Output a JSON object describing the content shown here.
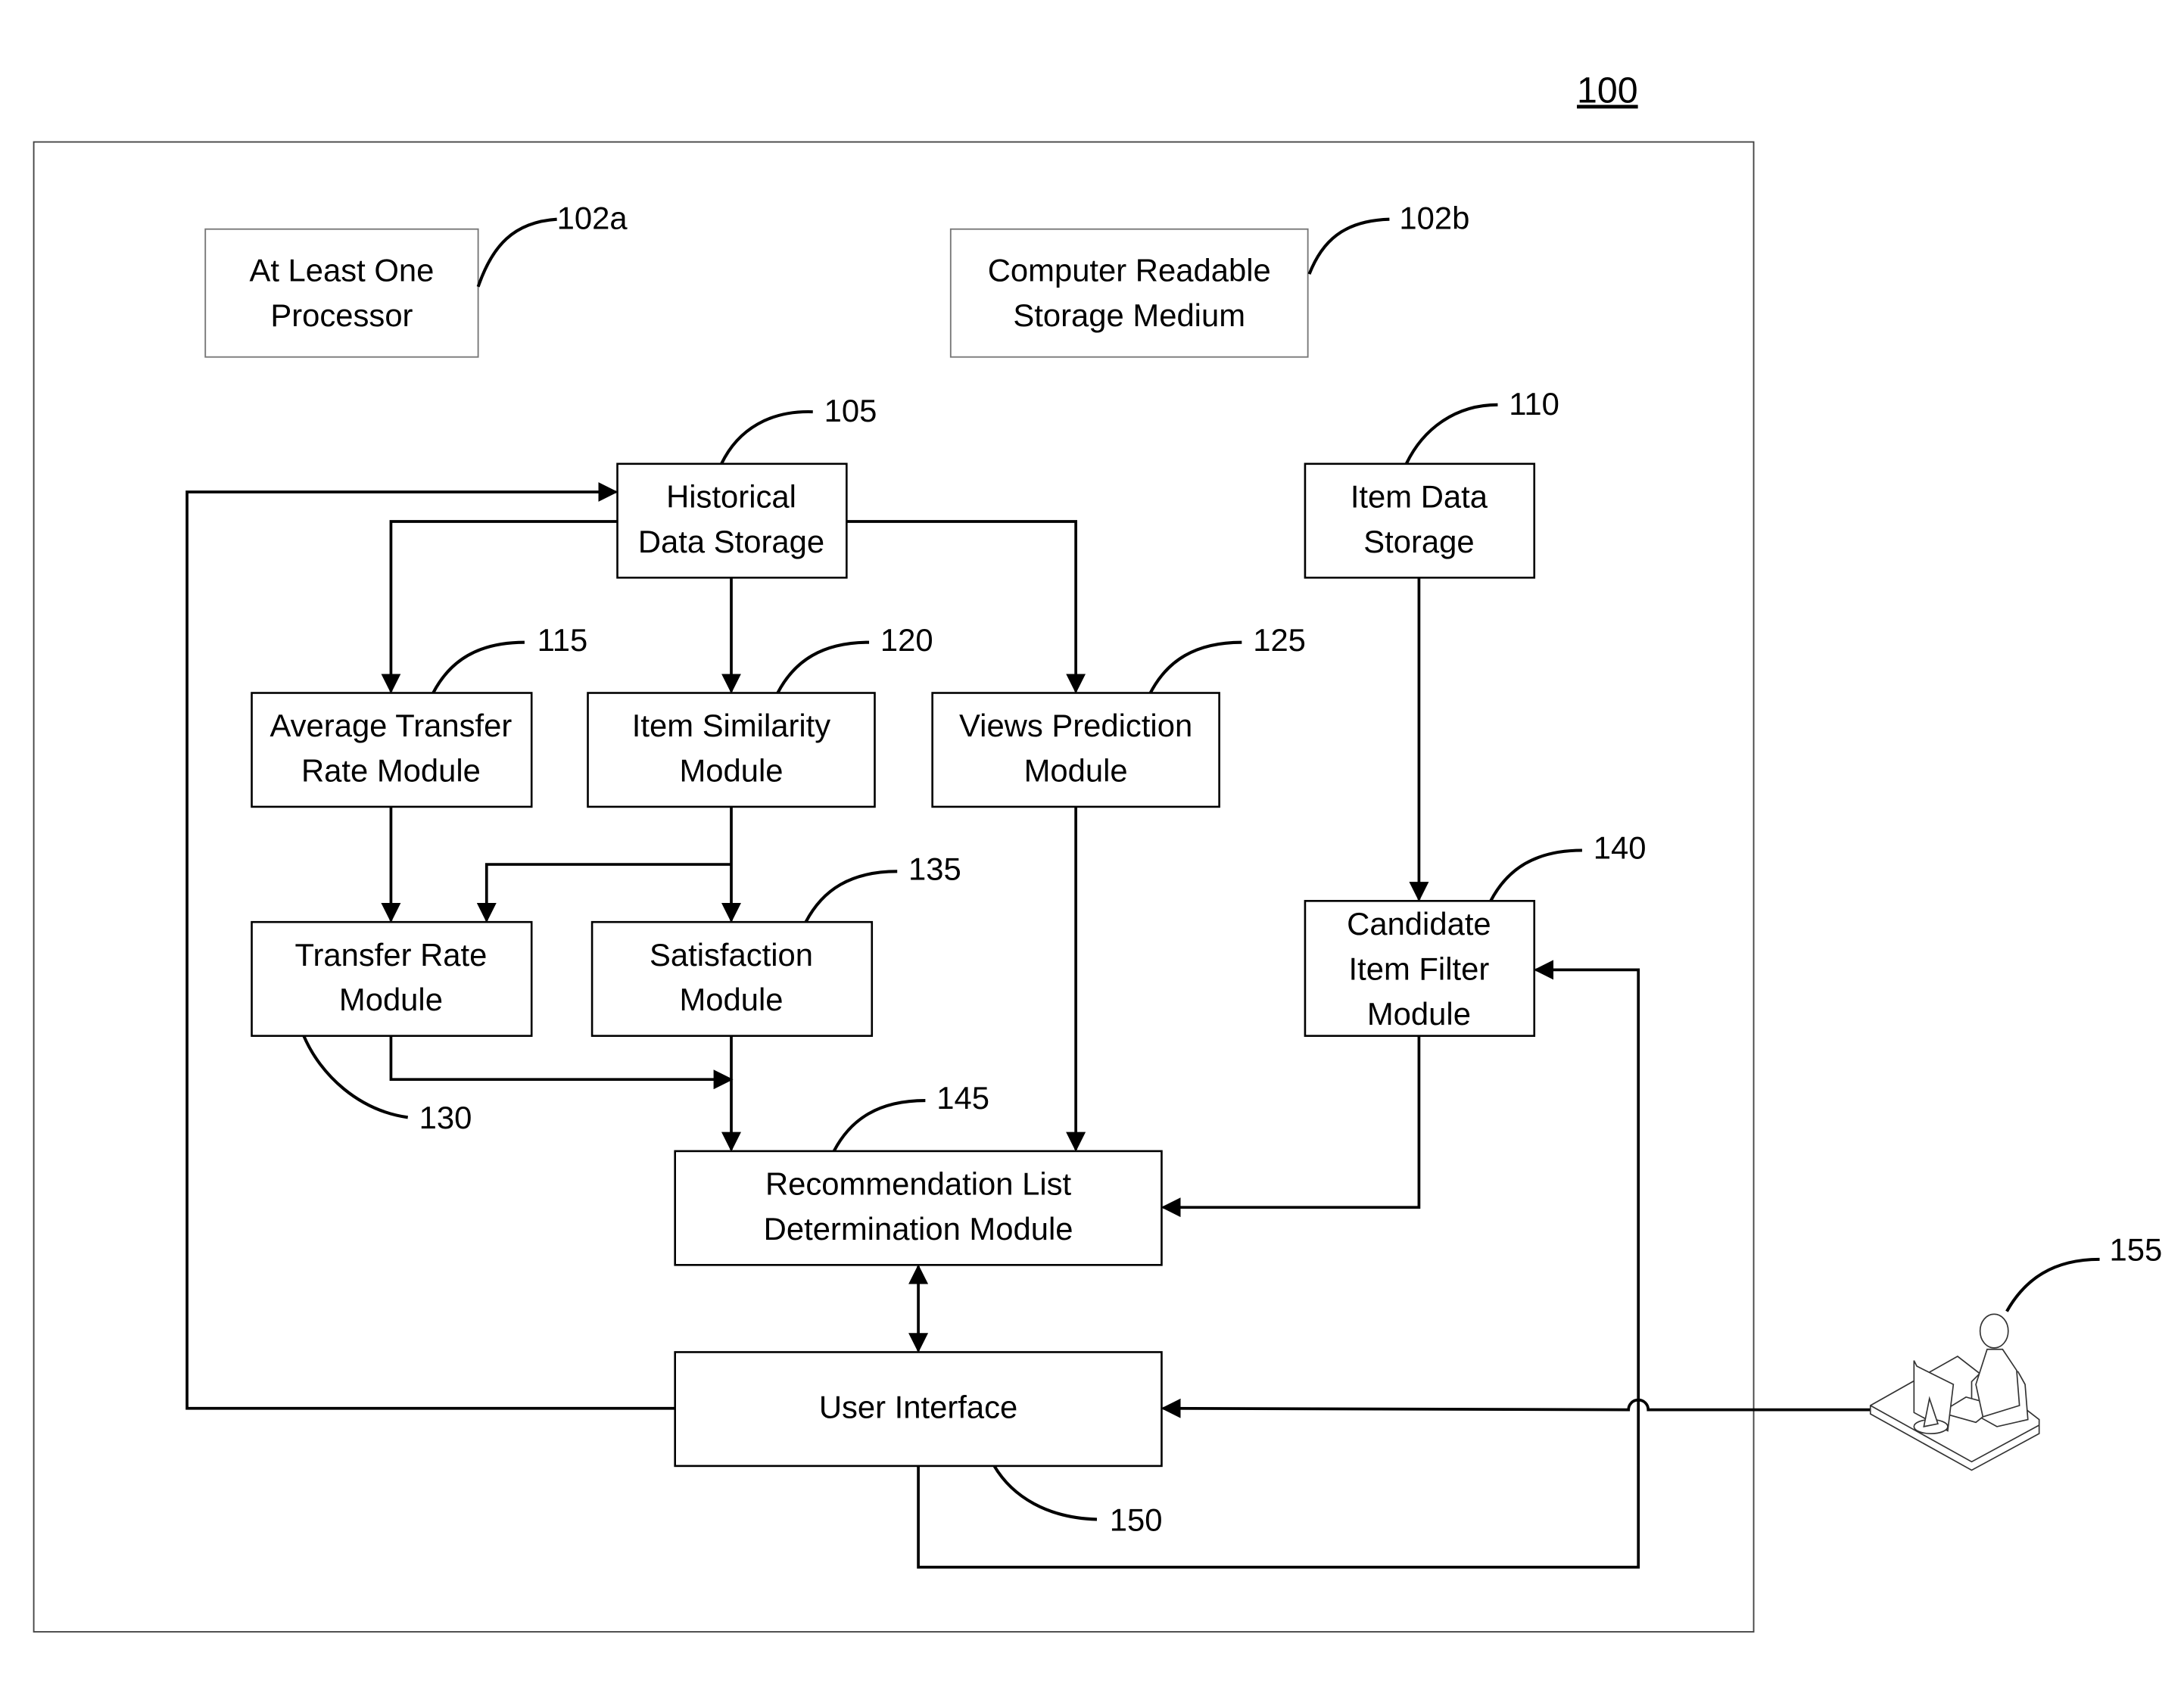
{
  "figure": {
    "number": "100"
  },
  "hardware": {
    "processor": {
      "ref": "102a",
      "lines": [
        "At Least One",
        "Processor"
      ]
    },
    "storage_medium": {
      "ref": "102b",
      "lines": [
        "Computer Readable",
        "Storage Medium"
      ]
    }
  },
  "modules": {
    "historical_data_storage": {
      "ref": "105",
      "lines": [
        "Historical",
        "Data Storage"
      ]
    },
    "item_data_storage": {
      "ref": "110",
      "lines": [
        "Item Data",
        "Storage"
      ]
    },
    "average_transfer_rate": {
      "ref": "115",
      "lines": [
        "Average Transfer",
        "Rate Module"
      ]
    },
    "item_similarity": {
      "ref": "120",
      "lines": [
        "Item Similarity",
        "Module"
      ]
    },
    "views_prediction": {
      "ref": "125",
      "lines": [
        "Views Prediction",
        "Module"
      ]
    },
    "transfer_rate": {
      "ref": "130",
      "lines": [
        "Transfer Rate",
        "Module"
      ]
    },
    "satisfaction": {
      "ref": "135",
      "lines": [
        "Satisfaction",
        "Module"
      ]
    },
    "candidate_item_filter": {
      "ref": "140",
      "lines": [
        "Candidate",
        "Item Filter",
        "Module"
      ]
    },
    "recommendation_list": {
      "ref": "145",
      "lines": [
        "Recommendation List",
        "Determination Module"
      ]
    },
    "user_interface": {
      "ref": "150",
      "lines": [
        "User Interface"
      ]
    }
  },
  "user": {
    "ref": "155",
    "icon": "user-at-computer-icon"
  }
}
